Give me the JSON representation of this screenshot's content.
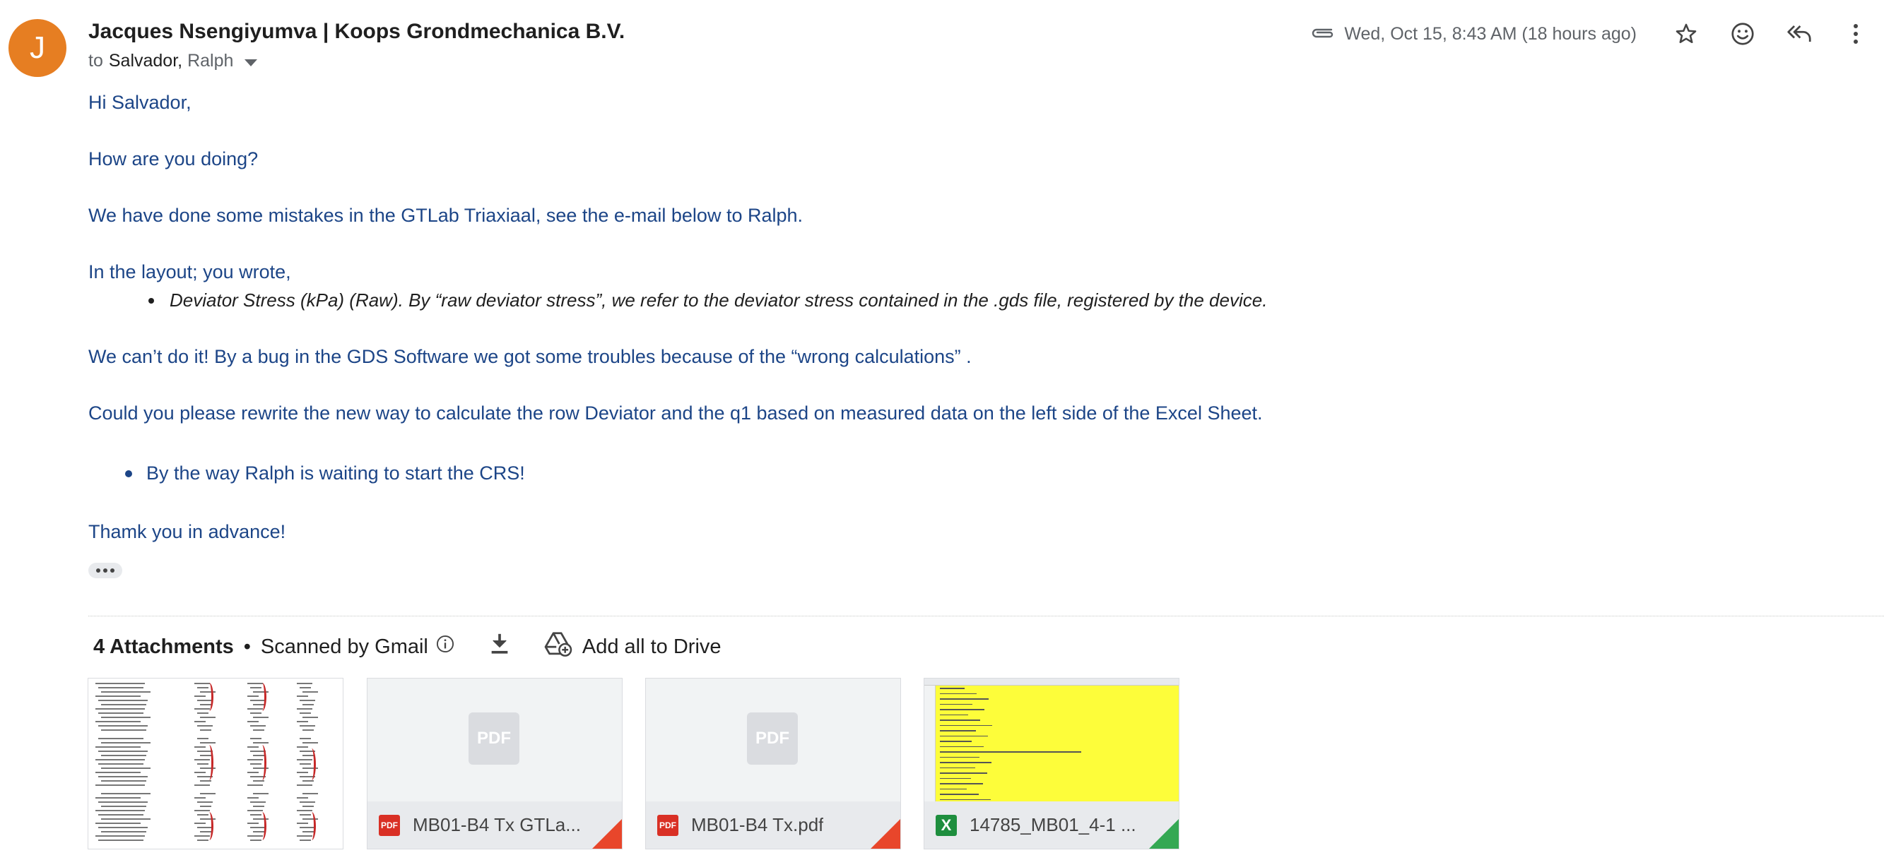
{
  "sender": {
    "avatar_letter": "J",
    "name": "Jacques Nsengiyumva | Koops Grondmechanica B.V.",
    "to_word": "to",
    "recipient_1": "Salvador,",
    "recipient_2": "Ralph"
  },
  "header": {
    "date": "Wed, Oct 15, 8:43 AM (18 hours ago)",
    "icons": [
      "paperclip-icon",
      "star-icon",
      "emoji-icon",
      "reply-icon",
      "more-vert-icon"
    ]
  },
  "body": {
    "greeting": "Hi Salvador,",
    "line_1": "How are you doing?",
    "line_2": "We have done some mistakes in the GTLab Triaxiaal, see the e-mail below to Ralph.",
    "line_3": "In the layout; you wrote,",
    "bullet_quote": "Deviator Stress (kPa) (Raw). By “raw deviator stress”, we refer to the deviator stress contained in the .gds file, registered by the device.",
    "line_4": "We can’t do it! By a bug in the GDS Software we got some troubles because of the “wrong calculations” .",
    "line_5": "Could you please rewrite the new way to calculate the row Deviator and the q1 based on measured data on the left side of the Excel Sheet.",
    "bullet_note": "By the way Ralph is waiting to start the CRS!",
    "closing": "Thamk you in advance!"
  },
  "attachments": {
    "count_label": "4 Attachments",
    "separator": "•",
    "scanned_label": "Scanned by Gmail",
    "add_drive_label": "Add all to Drive",
    "placeholder_label": "PDF",
    "files": [
      {
        "name": "MB01-B4 Tx GTLa...",
        "type": "PDF"
      },
      {
        "name": "MB01-B4 Tx.pdf",
        "type": "PDF"
      },
      {
        "name": "14785_MB01_4-1 ...",
        "type": "X"
      }
    ]
  },
  "colors": {
    "avatar": "#e67e22",
    "body_text": "#1c4587",
    "pdf_badge": "#d93025",
    "sheet_badge": "#1e8e3e"
  }
}
